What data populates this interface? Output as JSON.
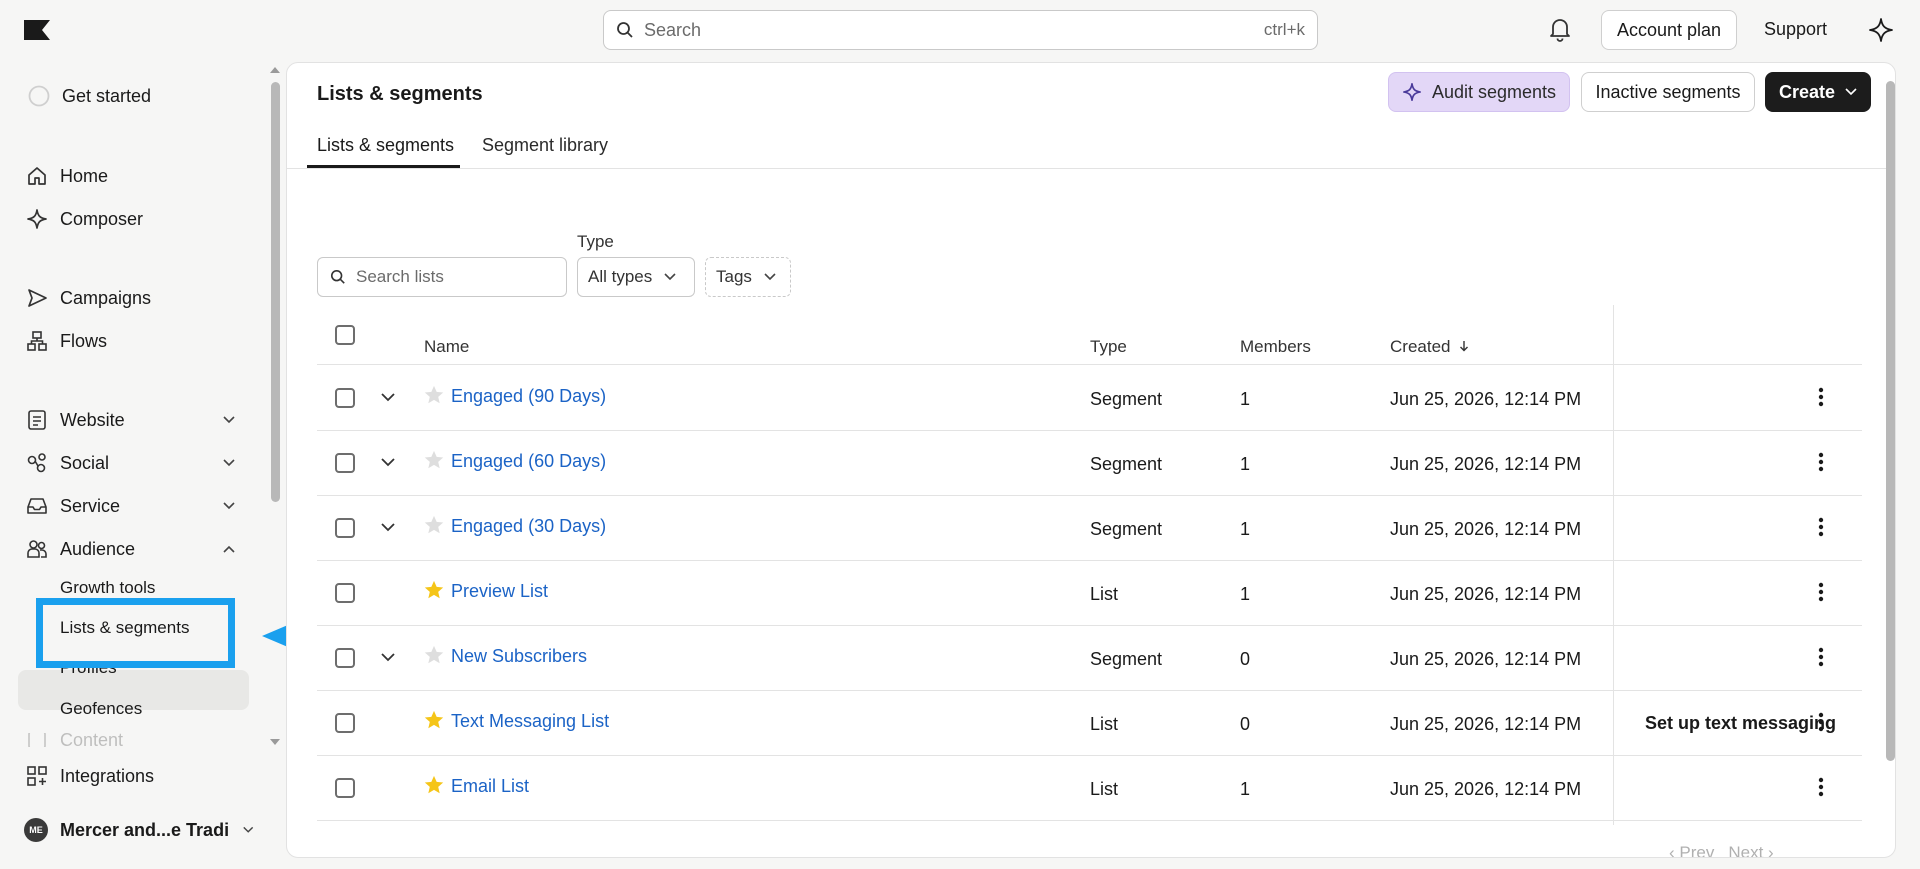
{
  "topbar": {
    "search_placeholder": "Search",
    "search_shortcut": "ctrl+k",
    "account_plan": "Account plan",
    "support": "Support"
  },
  "sidebar": {
    "get_started": "Get started",
    "home": "Home",
    "composer": "Composer",
    "campaigns": "Campaigns",
    "flows": "Flows",
    "website": "Website",
    "social": "Social",
    "service": "Service",
    "audience": "Audience",
    "audience_sub": [
      "Growth tools",
      "Lists & segments",
      "Profiles",
      "Geofences"
    ],
    "content": "Content",
    "integrations": "Integrations",
    "account_initials": "ME",
    "account_name": "Mercer and...e Trading"
  },
  "main": {
    "title": "Lists & segments",
    "audit_segments": "Audit segments",
    "inactive_segments": "Inactive segments",
    "create": "Create",
    "tabs": [
      "Lists & segments",
      "Segment library"
    ],
    "filter_type_label": "Type",
    "search_lists_placeholder": "Search lists",
    "type_select": "All types",
    "tags_select": "Tags",
    "columns": {
      "name": "Name",
      "type": "Type",
      "members": "Members",
      "created": "Created"
    },
    "rows": [
      {
        "name": "Engaged (90 Days)",
        "type": "Segment",
        "members": "1",
        "created": "Jun 25, 2026, 12:14 PM",
        "starred": false,
        "expandable": true,
        "action": ""
      },
      {
        "name": "Engaged (60 Days)",
        "type": "Segment",
        "members": "1",
        "created": "Jun 25, 2026, 12:14 PM",
        "starred": false,
        "expandable": true,
        "action": ""
      },
      {
        "name": "Engaged (30 Days)",
        "type": "Segment",
        "members": "1",
        "created": "Jun 25, 2026, 12:14 PM",
        "starred": false,
        "expandable": true,
        "action": ""
      },
      {
        "name": "Preview List",
        "type": "List",
        "members": "1",
        "created": "Jun 25, 2026, 12:14 PM",
        "starred": true,
        "expandable": false,
        "action": ""
      },
      {
        "name": "New Subscribers",
        "type": "Segment",
        "members": "0",
        "created": "Jun 25, 2026, 12:14 PM",
        "starred": false,
        "expandable": true,
        "action": ""
      },
      {
        "name": "Text Messaging List",
        "type": "List",
        "members": "0",
        "created": "Jun 25, 2026, 12:14 PM",
        "starred": true,
        "expandable": false,
        "action": "Set up text messaging"
      },
      {
        "name": "Email List",
        "type": "List",
        "members": "1",
        "created": "Jun 25, 2026, 12:14 PM",
        "starred": true,
        "expandable": false,
        "action": ""
      }
    ],
    "pager_prev": "Prev",
    "pager_next": "Next"
  },
  "colors": {
    "accent_link": "#1b63c6",
    "highlight": "#1aa0ee",
    "star": "#f5c518"
  }
}
